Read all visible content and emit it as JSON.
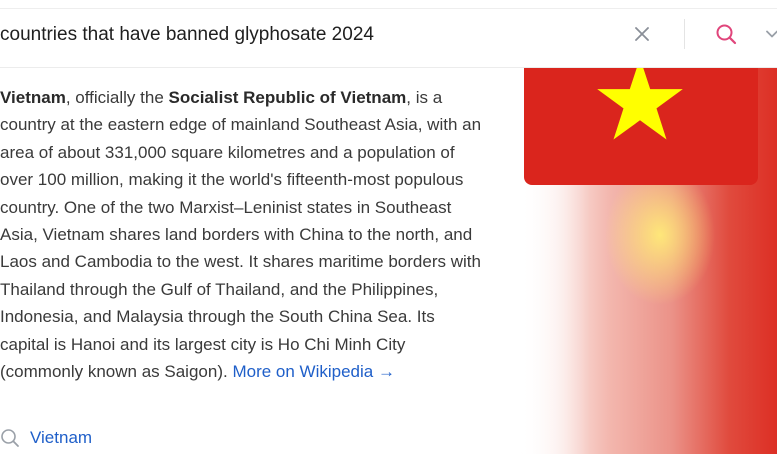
{
  "search": {
    "query": "countries that have banned glyphosate 2024",
    "clear_icon": "close-icon",
    "search_icon": "search-icon",
    "expand_icon": "chevron-down-icon"
  },
  "summary": {
    "name": "Vietnam",
    "p1": ", officially the ",
    "official_name": "Socialist Republic of Vietnam",
    "p2": ", is a country at the eastern edge of mainland Southeast Asia, with an area of about 331,000 square kilometres and a population of over 100 million, making it the world's fifteenth-most populous country. One of the two Marxist–Leninist states in Southeast Asia, Vietnam shares land borders with China to the north, and Laos and Cambodia to the west. It shares maritime borders with Thailand through the Gulf of Thailand, and the Philippines, Indonesia, and Malaysia through the South China Sea. Its capital is Hanoi and its largest city is Ho Chi Minh City (commonly known as Saigon).",
    "link_text": "More on Wikipedia →"
  },
  "related": {
    "icon": "search-icon",
    "label": "Vietnam"
  },
  "colors": {
    "flag_red": "#da251d",
    "flag_star": "#ffff00",
    "link_blue": "#1f5fc9",
    "search_icon_pink": "#e0457b"
  }
}
